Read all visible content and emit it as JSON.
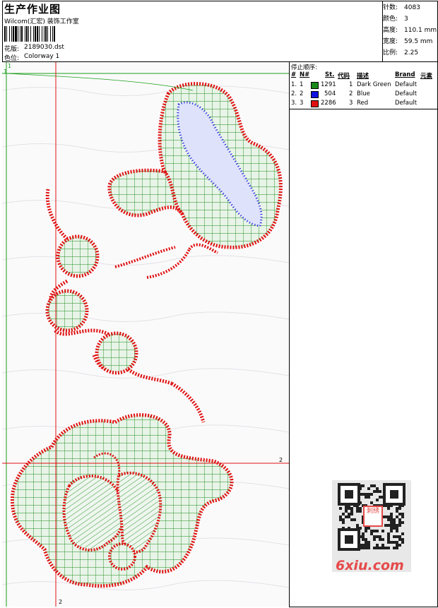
{
  "header": {
    "title": "生产作业图",
    "studio": "Wilcom(汇宏) 装饰工作室",
    "pattern_label": "花版:",
    "pattern_value": "2189030.dst",
    "colorway_label": "色位:",
    "colorway_value": "Colorway 1"
  },
  "stats": [
    {
      "label": "针数:",
      "value": "4083"
    },
    {
      "label": "颜色:",
      "value": "3"
    },
    {
      "label": "高度:",
      "value": "110.1 mm"
    },
    {
      "label": "宽度:",
      "value": "59.5 mm"
    },
    {
      "label": "比例:",
      "value": "2.25"
    }
  ],
  "legend": {
    "title": "停止顺序:",
    "headers": {
      "num": "#",
      "no": "N#",
      "st": "St.",
      "code": "代码",
      "desc": "描述",
      "brand": "Brand",
      "elem": "元素"
    },
    "rows": [
      {
        "num": "1.",
        "no": "1",
        "color": "#1a8a1a",
        "st": "1291",
        "code": "1",
        "desc": "Dark Green",
        "brand": "Default"
      },
      {
        "num": "2.",
        "no": "2",
        "color": "#1010e0",
        "st": "504",
        "code": "2",
        "desc": "Blue",
        "brand": "Default"
      },
      {
        "num": "3.",
        "no": "3",
        "color": "#e01010",
        "st": "2286",
        "code": "3",
        "desc": "Red",
        "brand": "Default"
      }
    ]
  },
  "canvas": {
    "guide_h1": "1",
    "guide_v1": "1",
    "guide_h2": "2",
    "guide_v2": "2"
  },
  "watermark": "6xiu.com",
  "qr_text": "刺绣"
}
